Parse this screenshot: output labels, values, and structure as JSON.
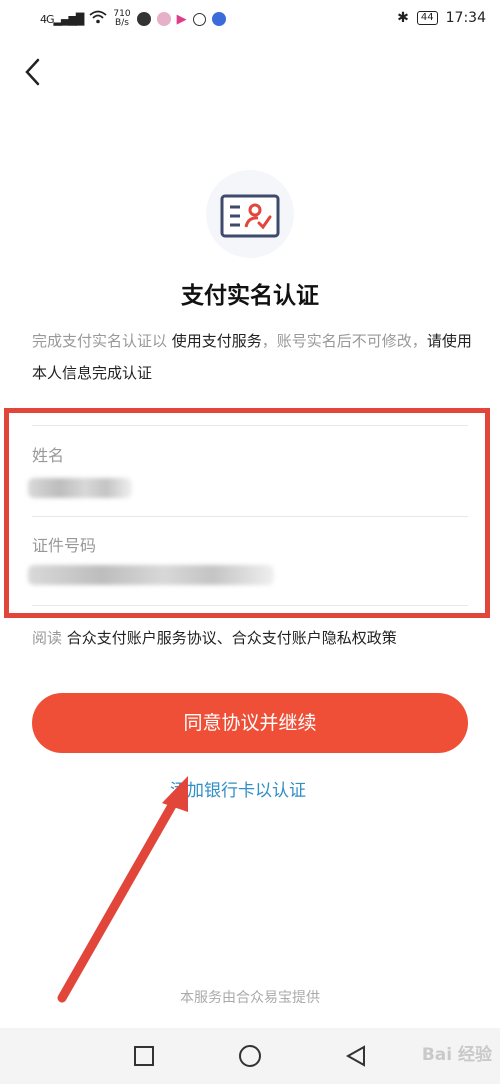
{
  "status_bar": {
    "signal": "4G",
    "speed_value": "710",
    "speed_unit": "B/s",
    "battery": "44",
    "time": "17:34"
  },
  "header": {
    "back_icon": "chevron-left-icon"
  },
  "logo": {
    "icon": "id-card-check-icon",
    "accent": "#e2463a",
    "ink": "#3d4a6b"
  },
  "title": "支付实名认证",
  "description": {
    "part1": "完成支付实名认证以 ",
    "part2": "使用支付服务",
    "part3": "，账号实名后不可修改，",
    "part4": "请使用本人信息完成认证"
  },
  "form": {
    "name_label": "姓名",
    "id_label": "证件号码"
  },
  "agreement": {
    "prefix": "阅读 ",
    "links": "合众支付账户服务协议、合众支付账户隐私权政策"
  },
  "buttons": {
    "continue": "同意协议并继续",
    "bank_card": "添加银行卡以认证"
  },
  "footer": "本服务由合众易宝提供",
  "watermark": "Bai 经验",
  "colors": {
    "primary": "#f04f37",
    "link": "#2f8fc6",
    "highlight_frame": "#e2463a"
  }
}
